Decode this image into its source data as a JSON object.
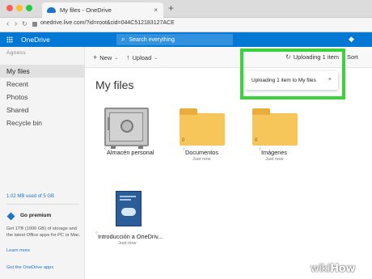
{
  "browser": {
    "tab_title": "My files - OneDrive",
    "tab_close": "×",
    "new_tab": "+",
    "url": "onedrive.live.com/?id=root&cid=044C512183127ACE"
  },
  "app": {
    "brand": "OneDrive",
    "search_placeholder": "Search everything"
  },
  "sidebar": {
    "user_name": "Agness",
    "items": [
      {
        "label": "My files",
        "active": true
      },
      {
        "label": "Recent"
      },
      {
        "label": "Photos"
      },
      {
        "label": "Shared"
      },
      {
        "label": "Recycle bin"
      }
    ],
    "storage": "1.02 MB used of 5 GB",
    "premium_title": "Go premium",
    "premium_desc": "Get 1TB (1000 GB) of storage and the latest Office apps for PC or Mac.",
    "premium_link": "Learn more",
    "apps_link": "Get the OneDrive apps"
  },
  "commands": {
    "new": "New",
    "upload": "Upload",
    "uploading": "Uploading 1 item",
    "sort": "Sort"
  },
  "toast": {
    "message": "Uploading 1 item to My files",
    "close": "×"
  },
  "main": {
    "title": "My files",
    "tiles": [
      {
        "name": "Almacén personal",
        "sub": ""
      },
      {
        "name": "Documentos",
        "sub": "Just now",
        "count": "0"
      },
      {
        "name": "Imágenes",
        "sub": "Just now",
        "count": "0"
      },
      {
        "name": "Introducción a OneDriv...",
        "sub": "Just now"
      }
    ]
  },
  "watermark": {
    "wiki": "wiki",
    "how": "How"
  },
  "colors": {
    "accent": "#0078d4",
    "highlight": "#3bd33b",
    "folder": "#f7c65a"
  }
}
